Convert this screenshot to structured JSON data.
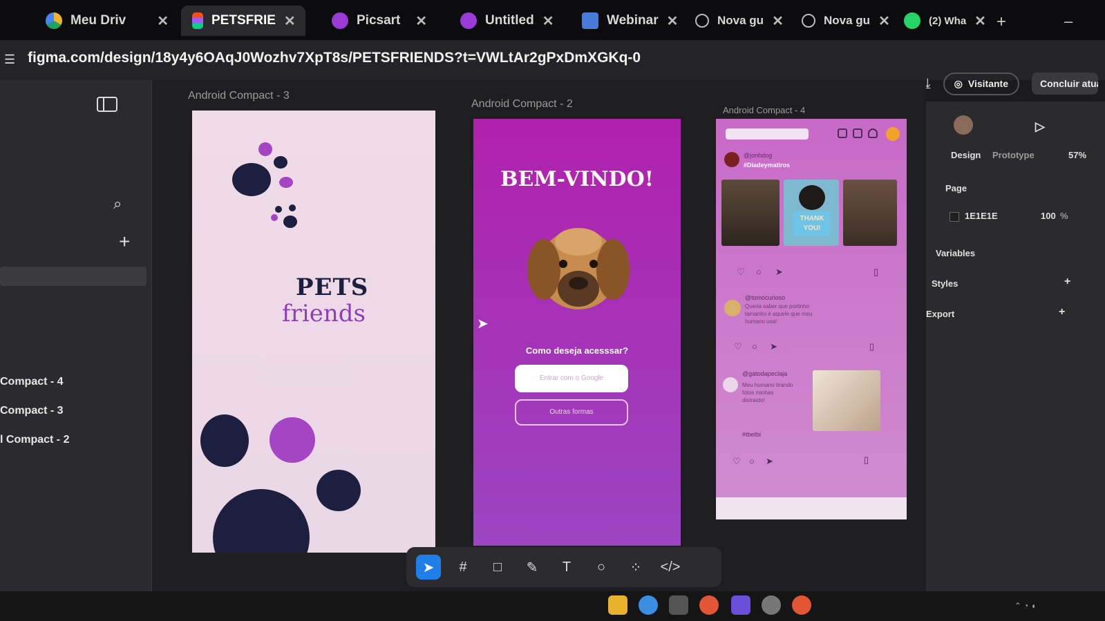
{
  "browser": {
    "tabs": [
      {
        "label": "Meu Driv",
        "icon": "google-drive-icon",
        "color": "#f2b42a",
        "active": false
      },
      {
        "label": "PETSFRIE",
        "icon": "figma-icon",
        "color": "#f24e1e",
        "active": true
      },
      {
        "label": "Picsart",
        "icon": "picsart-icon",
        "color": "#9b3bd6",
        "active": false
      },
      {
        "label": "Untitled",
        "icon": "picsart-icon",
        "color": "#9b3bd6",
        "active": false
      },
      {
        "label": "Webinar",
        "icon": "meeting-icon",
        "color": "#4a7ad8",
        "active": false
      },
      {
        "label": "Nova gu",
        "icon": "globe-icon",
        "color": "#bbbbbb",
        "active": false
      },
      {
        "label": "Nova gu",
        "icon": "globe-icon",
        "color": "#bbbbbb",
        "active": false
      },
      {
        "label": "(2) Wha",
        "icon": "whatsapp-icon",
        "color": "#25d366",
        "active": false
      }
    ],
    "tab_close": "✕",
    "new_tab": "+",
    "minimize": "–",
    "url": "figma.com/design/18y4y6OAqJ0Wozhv7XpT8s/PETSFRIENDS?t=VWLtAr2gPxDmXGKq-0"
  },
  "figma_header": {
    "visitor_label": "Visitante",
    "finish_label": "Concluir atualiz"
  },
  "left_panel": {
    "layers": [
      "Compact - 4",
      "Compact - 3",
      "l Compact - 2"
    ]
  },
  "canvas": {
    "frames": {
      "frame3_label": "Android Compact - 3",
      "frame2_label": "Android Compact - 2",
      "frame4_label": "Android Compact - 4"
    },
    "splash": {
      "title_line1": "PETS",
      "title_line2": "friends"
    },
    "welcome": {
      "title": "BEM-VINDO!",
      "question": "Como deseja acesssar?",
      "google_button": "Entrar com o Google",
      "other_button": "Outras formas"
    },
    "feed": {
      "post1_user": "@jonhdog",
      "post1_tag": "#Diadeymatiros",
      "post2_user": "@tomocurioso",
      "post2_text": "Queria saber que portinho tamanho é aquele que meu humano usa!",
      "post3_user": "@gatodapeclaja",
      "post3_text": "Meu humano tirando fotos minhas distraído!",
      "post3_tag": "#tbetbi",
      "photo_caption": "THANK YOU!"
    }
  },
  "right_panel": {
    "tab_design": "Design",
    "tab_prototype": "Prototype",
    "zoom": "57%",
    "page_label": "Page",
    "page_color": "1E1E1E",
    "page_opacity": "100",
    "page_opacity_unit": "%",
    "variables_label": "Variables",
    "styles_label": "Styles",
    "export_label": "Export"
  },
  "toolbar": {
    "tools": [
      "move-tool",
      "frame-tool",
      "rectangle-tool",
      "pen-tool",
      "text-tool",
      "comment-tool",
      "actions-tool",
      "dev-mode-tool"
    ]
  },
  "colors": {
    "accent": "#1f7ee8",
    "splash_bg": "#f0dbe8",
    "welcome_bg": "#b121ad",
    "feed_bg": "#c869c8",
    "navy": "#1c1f3f",
    "purple": "#8d40b5"
  }
}
